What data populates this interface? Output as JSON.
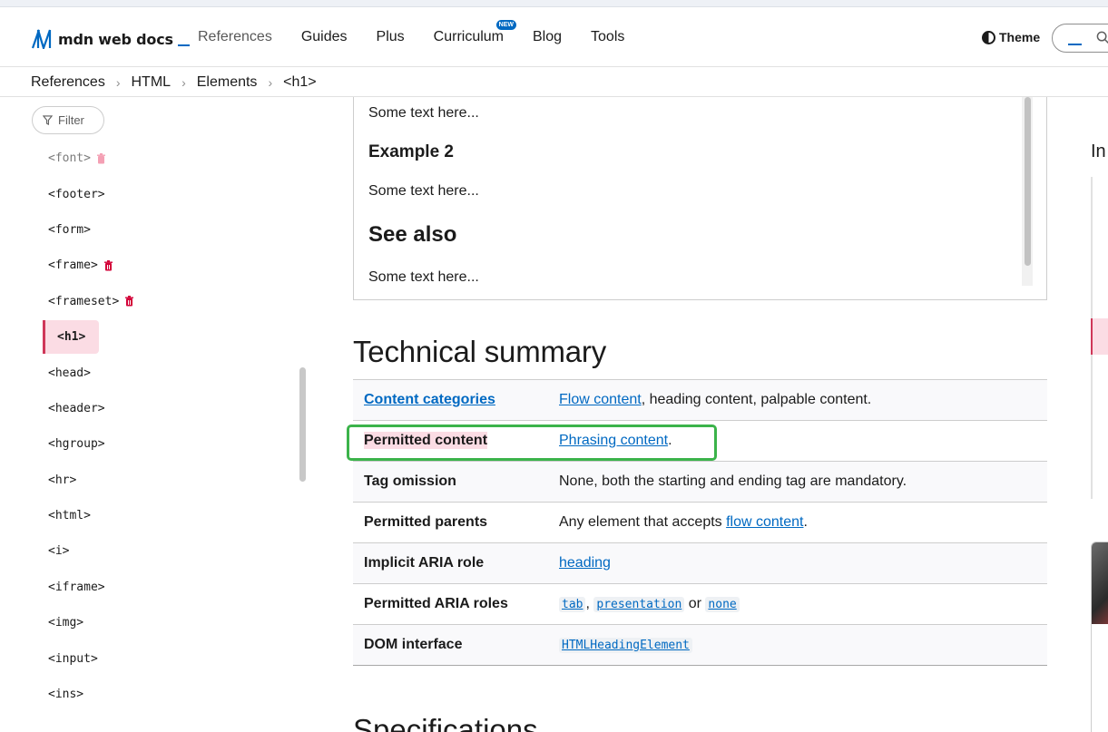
{
  "header": {
    "logo_text": "mdn web docs",
    "nav": [
      {
        "label": "References"
      },
      {
        "label": "Guides"
      },
      {
        "label": "Plus"
      },
      {
        "label": "Curriculum",
        "badge": "NEW"
      },
      {
        "label": "Blog"
      },
      {
        "label": "Tools"
      }
    ],
    "theme_label": "Theme"
  },
  "breadcrumbs": [
    "References",
    "HTML",
    "Elements",
    "<h1>"
  ],
  "sidebar": {
    "filter_label": "Filter",
    "items": [
      {
        "label": "<font>",
        "deprecated": true
      },
      {
        "label": "<footer>"
      },
      {
        "label": "<form>"
      },
      {
        "label": "<frame>",
        "deprecated": true
      },
      {
        "label": "<frameset>",
        "deprecated": true
      },
      {
        "label": "<h1>",
        "active": true
      },
      {
        "label": "<head>"
      },
      {
        "label": "<header>"
      },
      {
        "label": "<hgroup>"
      },
      {
        "label": "<hr>"
      },
      {
        "label": "<html>"
      },
      {
        "label": "<i>"
      },
      {
        "label": "<iframe>"
      },
      {
        "label": "<img>"
      },
      {
        "label": "<input>"
      },
      {
        "label": "<ins>"
      }
    ]
  },
  "example": {
    "text1": "Some text here...",
    "heading_example2": "Example 2",
    "text2": "Some text here...",
    "heading_see_also": "See also",
    "text3": "Some text here..."
  },
  "technical_summary": {
    "title": "Technical summary",
    "rows": {
      "content_categories": {
        "label": "Content categories",
        "link": "Flow content",
        "rest": ", heading content, palpable content."
      },
      "permitted_content": {
        "label": "Permitted content",
        "link": "Phrasing content",
        "rest": "."
      },
      "tag_omission": {
        "label": "Tag omission",
        "value": "None, both the starting and ending tag are mandatory."
      },
      "permitted_parents": {
        "label": "Permitted parents",
        "pre": "Any element that accepts ",
        "link": "flow content",
        "rest": "."
      },
      "implicit_aria_role": {
        "label": "Implicit ARIA role",
        "link": "heading"
      },
      "permitted_aria_roles": {
        "label": "Permitted ARIA roles",
        "role1": "tab",
        "sep1": ", ",
        "role2": "presentation",
        "sep2": " or ",
        "role3": "none"
      },
      "dom_interface": {
        "label": "DOM interface",
        "link": "HTMLHeadingElement"
      }
    }
  },
  "next_section_heading": "Specifications",
  "right_rail": {
    "toc_label": "In"
  },
  "colors": {
    "link": "#0069c2",
    "active_highlight": "#fbdce4",
    "active_border": "#cf3759",
    "annotation_box": "#3bb34a"
  }
}
